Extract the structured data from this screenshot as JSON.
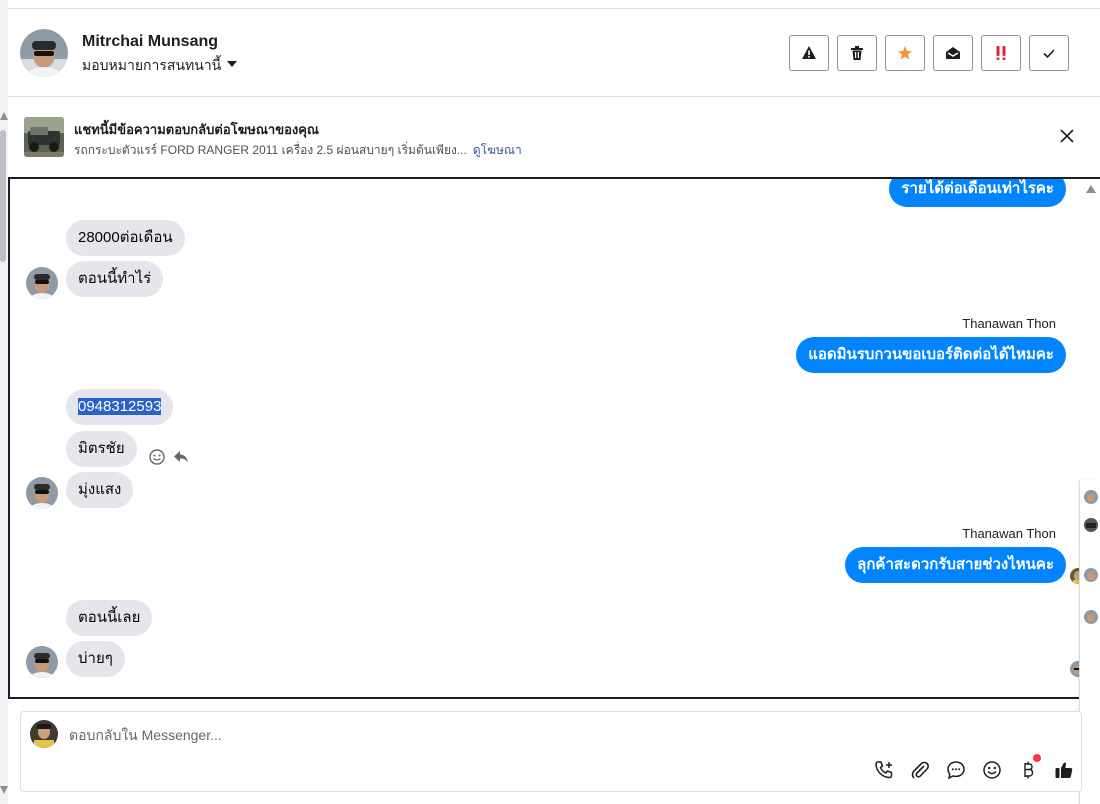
{
  "header": {
    "name": "Mitrchai Munsang",
    "assign_label": "มอบหมายการสนทนานี้",
    "actions": [
      "spam",
      "delete",
      "follow-up",
      "mark-unread",
      "important",
      "done"
    ]
  },
  "ad_banner": {
    "title": "แชทนี้มีข้อความตอบกลับต่อโฆษณาของคุณ",
    "description": "รถกระบะตัวแรร์ FORD RANGER 2011 เครื่อง 2.5 ผ่อนสบายๆ เริ่มต้นเพียง...",
    "link": "ดูโฆษณา"
  },
  "messages": {
    "m1": "รายได้ต่อเดือนเท่าไรคะ",
    "m2": "28000ต่อเดือน",
    "m3": "ตอนนี้ทำไร่",
    "sender1": "Thanawan Thon",
    "m4": "แอดมินรบกวนขอเบอร์ติดต่อได้ไหมคะ",
    "m5": "0948312593",
    "m6": "มิตรชัย",
    "m7": "มุ่งแสง",
    "sender2": "Thanawan Thon",
    "m8": "ลุกค้าสะดวกรับสายช่วงไหนคะ",
    "m9": "ตอนนี้เลย",
    "m10": "บ่ายๆ"
  },
  "composer": {
    "placeholder": "ตอบกลับใน Messenger..."
  },
  "colors": {
    "outgoing": "#0084ff",
    "incoming": "#e4e6eb",
    "selection": "#2a62c9",
    "link": "#385898",
    "important": "#e41e3f",
    "follow_up": "#f7923b"
  }
}
